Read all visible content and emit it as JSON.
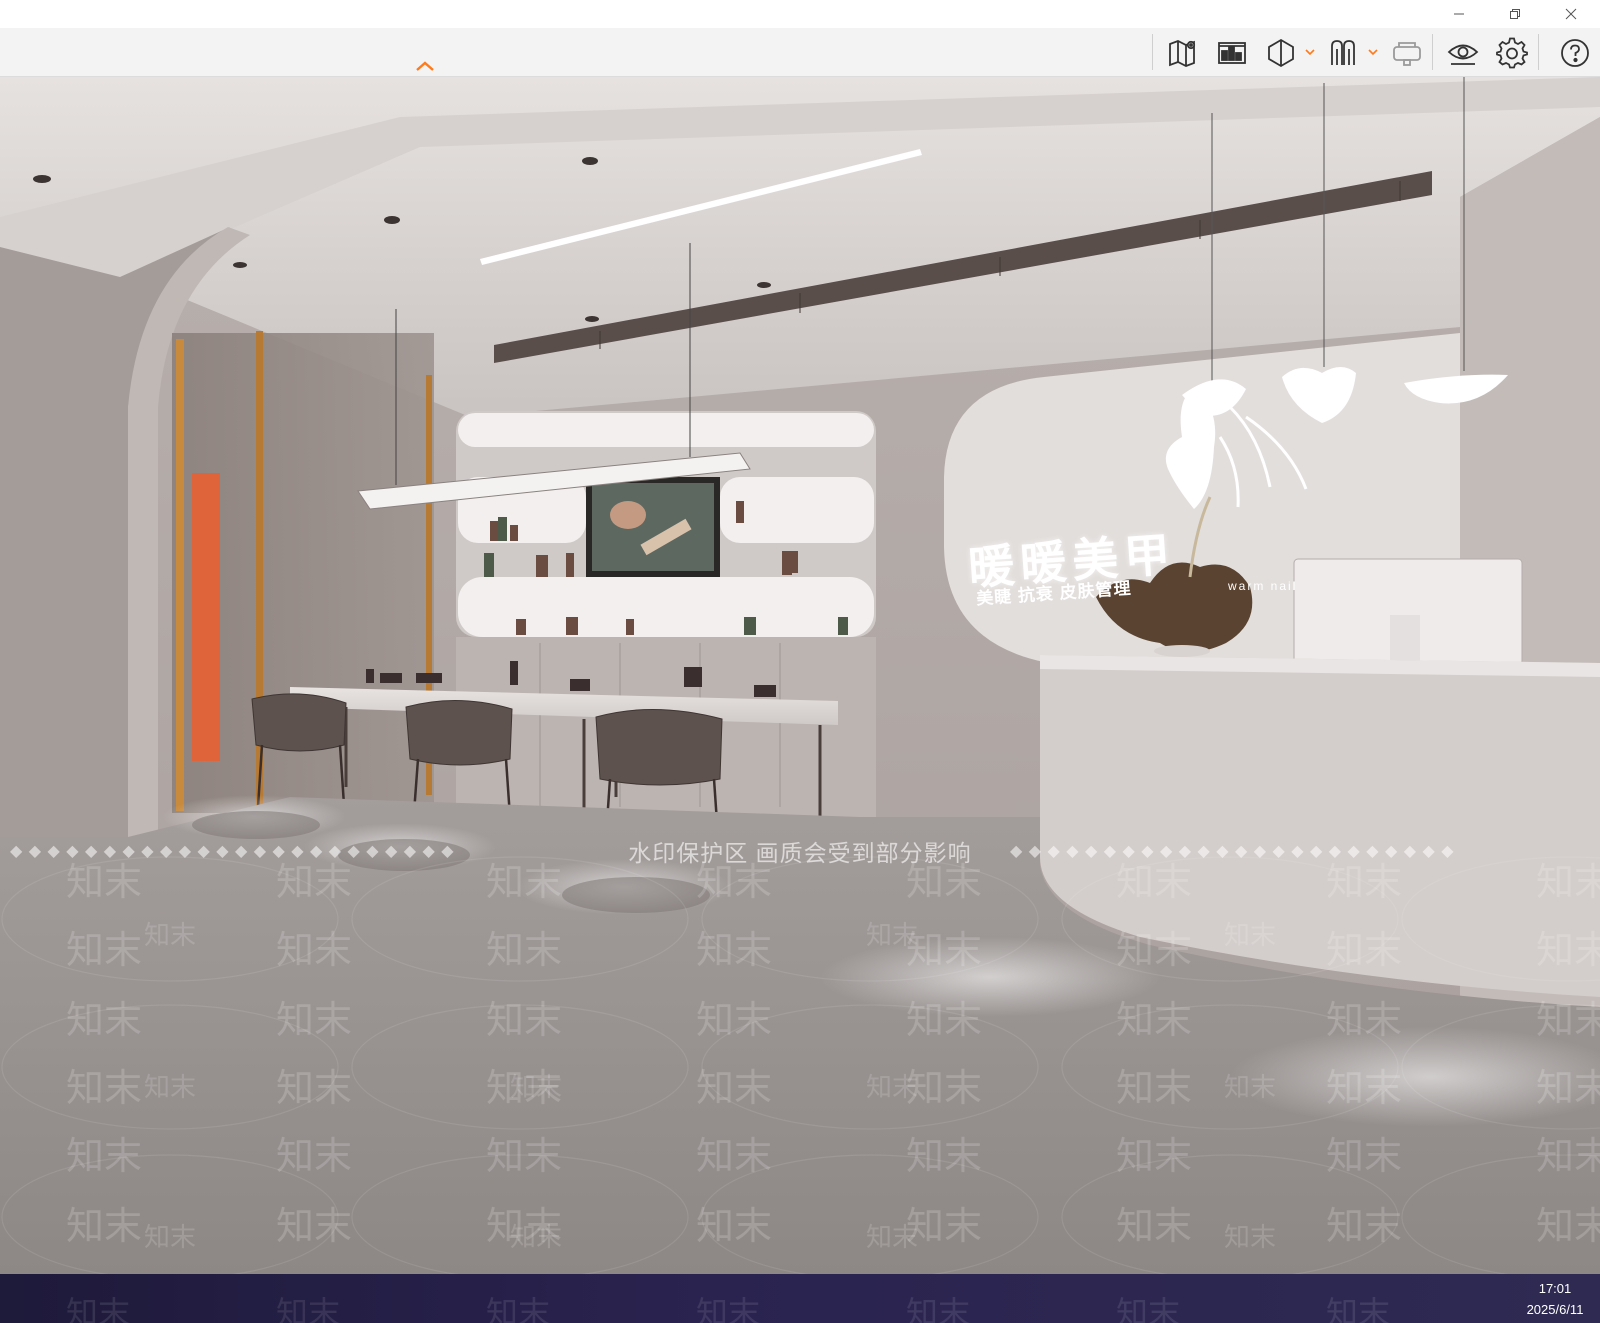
{
  "window": {
    "minimize_icon": "minimize-icon",
    "restore_icon": "restore-icon",
    "close_icon": "close-icon"
  },
  "toolbar": {
    "collapse_icon": "chevron-up-icon",
    "accent_color": "#ff7a1a",
    "icons": [
      "map-icon",
      "floorplan-icon",
      "3d-view-icon",
      "roaming-icon",
      "vr-headset-icon",
      "eye-icon",
      "gear-icon",
      "help-icon"
    ]
  },
  "scene": {
    "sign_title": "暖暖美甲",
    "sign_subtitle": "美睫 抗衰 皮肤管理",
    "sign_english": "warm  nail"
  },
  "watermark": {
    "banner": "水印保护区  画质会受到部分影响",
    "brand": "知末"
  },
  "taskbar": {
    "time": "17:01",
    "date": "2025/6/11"
  }
}
